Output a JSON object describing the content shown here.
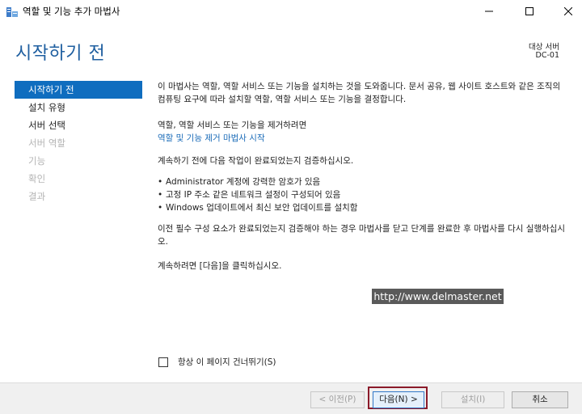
{
  "window": {
    "title": "역할 및 기능 추가 마법사",
    "app_icon": "server-manager-icon"
  },
  "header": {
    "page_title": "시작하기 전",
    "target_label": "대상 서버",
    "target_value": "DC-01"
  },
  "nav": {
    "items": [
      {
        "label": "시작하기 전",
        "state": "active"
      },
      {
        "label": "설치 유형",
        "state": "normal"
      },
      {
        "label": "서버 선택",
        "state": "normal"
      },
      {
        "label": "서버 역할",
        "state": "disabled"
      },
      {
        "label": "기능",
        "state": "disabled"
      },
      {
        "label": "확인",
        "state": "disabled"
      },
      {
        "label": "결과",
        "state": "disabled"
      }
    ]
  },
  "content": {
    "intro": "이 마법사는 역할, 역할 서비스 또는 기능을 설치하는 것을 도와줍니다. 문서 공유, 웹 사이트 호스트와 같은 조직의 컴퓨팅 요구에 따라 설치할 역할, 역할 서비스 또는 기능을 결정합니다.",
    "remove_text": "역할, 역할 서비스 또는 기능을 제거하려면",
    "remove_link": "역할 및 기능 제거 마법사 시작",
    "verify_text": "계속하기 전에 다음 작업이 완료되었는지 검증하십시오.",
    "bullets": [
      "Administrator 계정에 강력한 암호가 있음",
      "고정 IP 주소 같은 네트워크 설정이 구성되어 있음",
      "Windows 업데이트에서 최신 보안 업데이트를 설치함"
    ],
    "close_text": "이전 필수 구성 요소가 완료되었는지 검증해야 하는 경우 마법사를 닫고 단계를 완료한 후 마법사를 다시 실행하십시오.",
    "continue_text": "계속하려면 [다음]을 클릭하십시오."
  },
  "watermark": "http://www.delmaster.net",
  "skip_checkbox": {
    "label": "항상 이 페이지 건너뛰기(S)",
    "checked": false
  },
  "footer": {
    "prev_label": "< 이전(P)",
    "next_label": "다음(N) >",
    "install_label": "설치(I)",
    "cancel_label": "취소"
  },
  "colors": {
    "accent": "#0f6dbf",
    "title": "#1f5fa0",
    "link": "#1a6bb8",
    "highlight": "#8b1a2a"
  }
}
